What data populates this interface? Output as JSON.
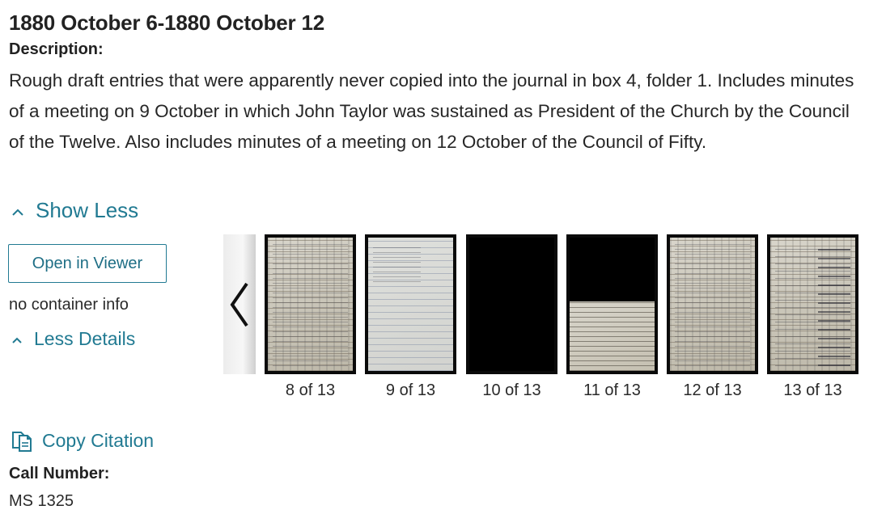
{
  "record": {
    "title": "1880 October 6-1880 October 12",
    "description_label": "Description:",
    "description_text": "Rough draft entries that were apparently never copied into the journal in box 4, folder 1. Includes minutes of a meeting on 9 October in which John Taylor was sustained as President of the Church by the Council of the Twelve. Also includes minutes of a meeting on 12 October of the Council of Fifty.",
    "show_less_label": "Show Less"
  },
  "sidebar": {
    "open_viewer_label": "Open in Viewer",
    "container_info": "no container info",
    "less_details_label": "Less Details"
  },
  "carousel": {
    "prev_icon": "chevron-left-icon",
    "thumbnails": [
      {
        "label": "8 of 13"
      },
      {
        "label": "9 of 13"
      },
      {
        "label": "10 of 13"
      },
      {
        "label": "11 of 13"
      },
      {
        "label": "12 of 13"
      },
      {
        "label": "13 of 13"
      }
    ]
  },
  "citation": {
    "copy_label": "Copy Citation",
    "icon": "copy-document-icon"
  },
  "call_number": {
    "label": "Call Number:",
    "value": "MS 1325"
  },
  "colors": {
    "link": "#217a92",
    "text": "#222222"
  }
}
